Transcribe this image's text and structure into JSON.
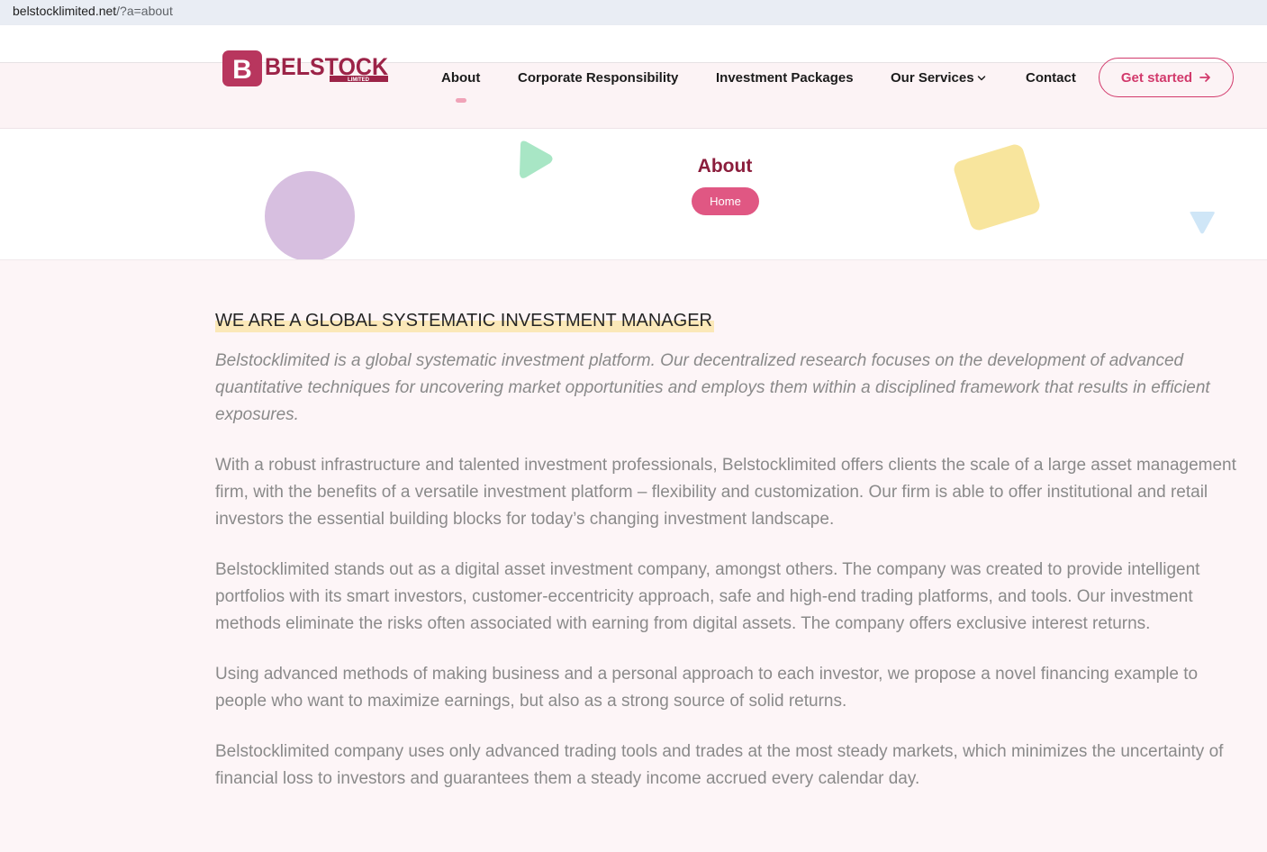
{
  "browser": {
    "url_host": "belstocklimited.net",
    "url_path": "/?a=about"
  },
  "header": {
    "logo": {
      "letter": "B",
      "wordmark": "BELSTOCK",
      "subtext": "LIMITED"
    },
    "nav": [
      {
        "label": "About",
        "active": true
      },
      {
        "label": "Corporate Responsibility"
      },
      {
        "label": "Investment Packages"
      },
      {
        "label": "Our Services",
        "icon": "chevron-down-icon"
      },
      {
        "label": "Contact"
      }
    ],
    "cta": {
      "label": "Get started",
      "icon": "arrow-right-icon"
    }
  },
  "title_band": {
    "title": "About",
    "breadcrumb_home": "Home"
  },
  "content": {
    "headline": "WE ARE A GLOBAL SYSTEMATIC INVESTMENT MANAGER",
    "lead": "Belstocklimited is a global systematic investment platform. Our decentralized research focuses on the development of advanced quantitative techniques for uncovering market opportunities and employs them within a disciplined framework that results in efficient exposures.",
    "paragraphs": [
      "With a robust infrastructure and talented investment professionals, Belstocklimited offers clients the scale of a large asset management firm, with the benefits of a versatile investment platform – flexibility and customization. Our firm is able to offer institutional and retail investors the essential building blocks for today’s changing investment landscape.",
      "Belstocklimited stands out as a digital asset investment company, amongst others. The company was created to provide intelligent portfolios with its smart investors, customer-eccentricity approach, safe and high-end trading platforms, and tools. Our investment methods eliminate the risks often associated with earning from digital assets. The company offers exclusive interest returns.",
      "Using advanced methods of making business and a personal approach to each investor, we propose a novel financing example to people who want to maximize earnings, but also as a strong source of solid returns.",
      "Belstocklimited company uses only advanced trading tools and trades at the most steady markets, which minimizes the uncertainty of financial loss to investors and guarantees them a steady income accrued every calendar day."
    ]
  },
  "colors": {
    "brand": "#8b1d3c",
    "accent": "#d23a6c",
    "pill": "#e05783",
    "highlight": "#fbe8b8",
    "deco_circle": "#d7bfe0",
    "deco_play": "#a8e6c5",
    "deco_square": "#f8e59d",
    "deco_triangle": "#cfe6f7"
  }
}
